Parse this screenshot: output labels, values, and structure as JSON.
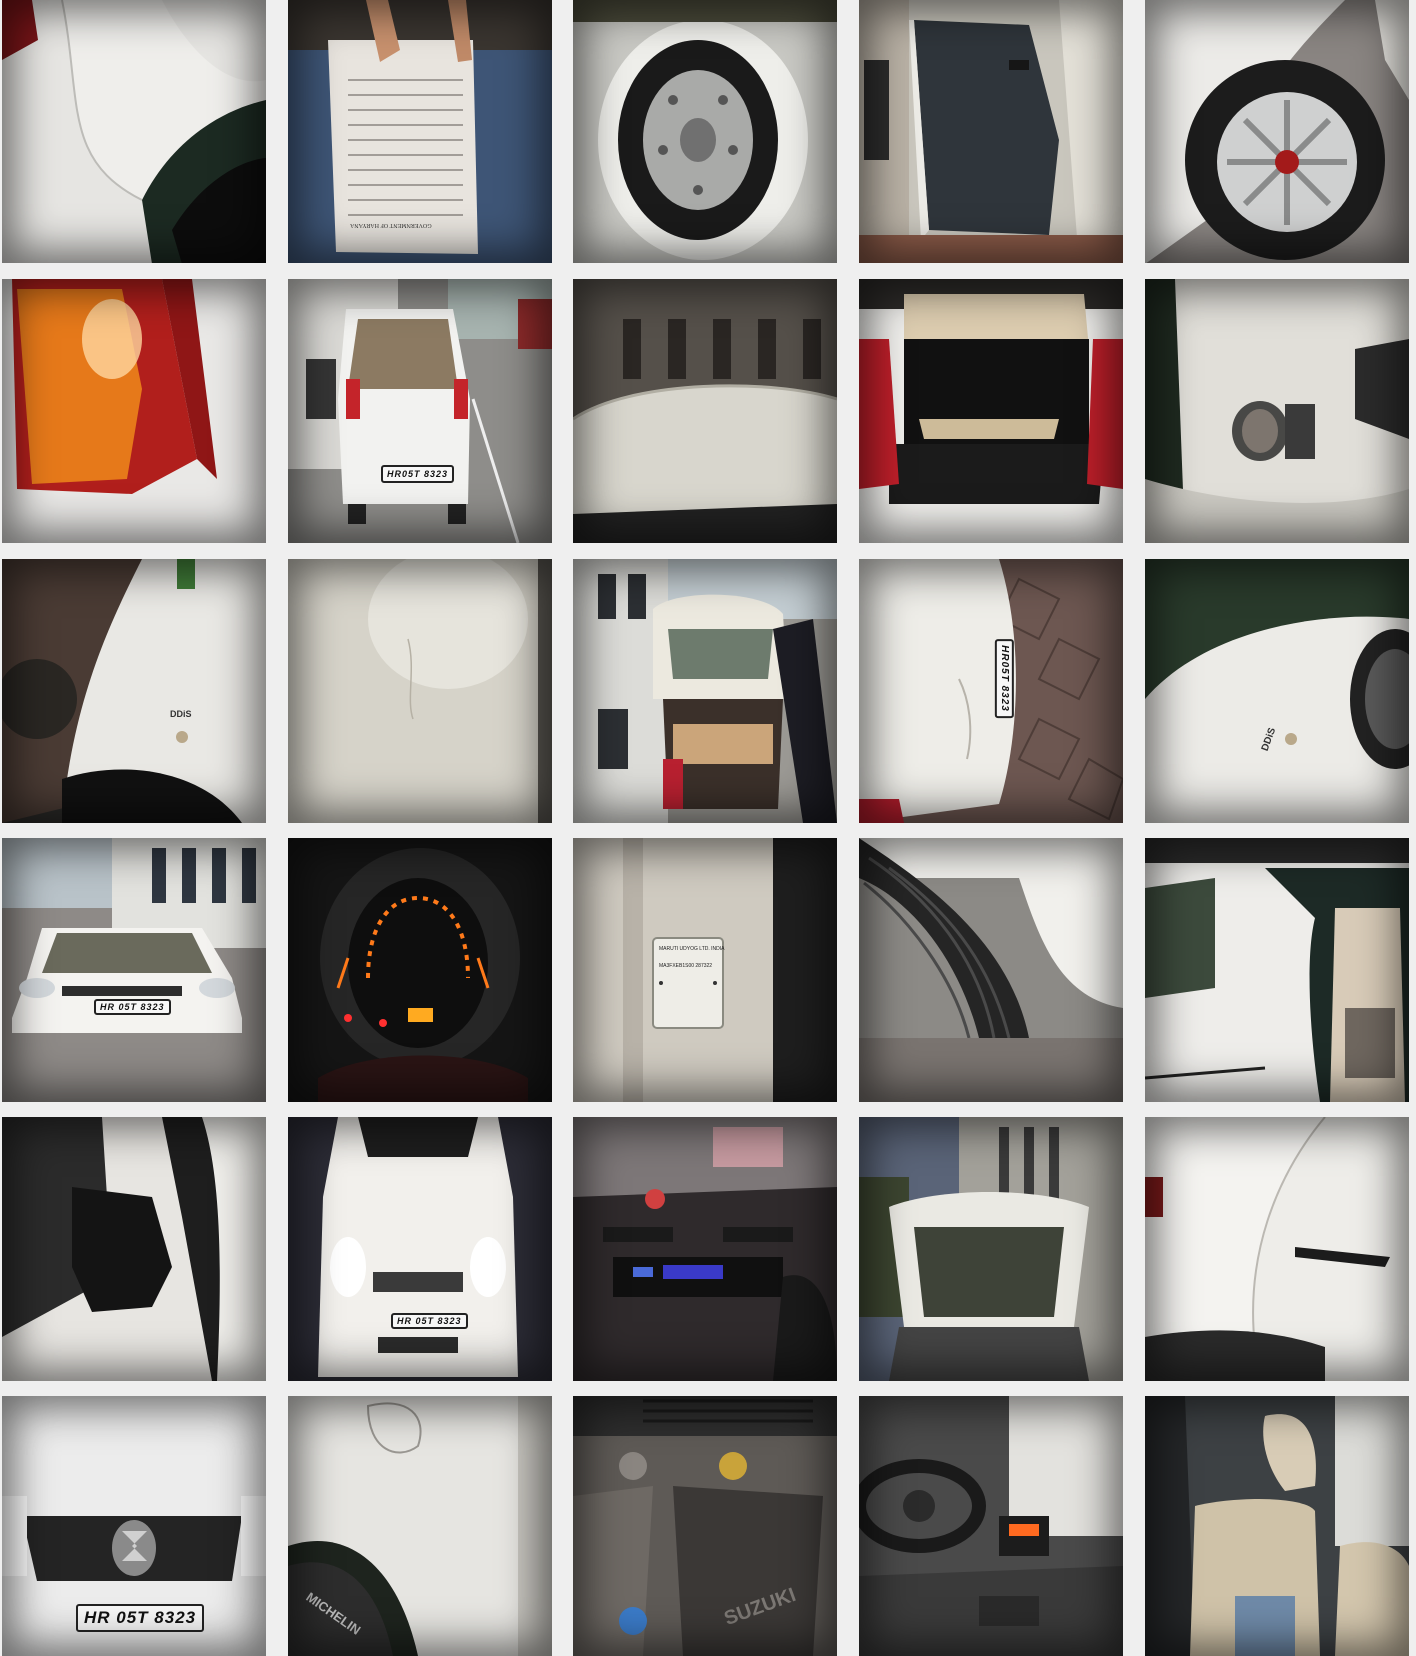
{
  "gallery": {
    "background": "#efefef",
    "tiles": [
      {
        "name": "rear-quarter-white-panel"
      },
      {
        "name": "registration-document",
        "doc_lines": [
          "GOVERNMENT OF HARYANA"
        ]
      },
      {
        "name": "spare-wheel-boot"
      },
      {
        "name": "open-door-interior-panel"
      },
      {
        "name": "front-wheel-hubcap"
      },
      {
        "name": "tail-lamp-closeup"
      },
      {
        "name": "rear-view-on-street",
        "plate": "HR05T 8323"
      },
      {
        "name": "roof-reflection"
      },
      {
        "name": "boot-open-seat-back"
      },
      {
        "name": "fog-lamp-bumper"
      },
      {
        "name": "front-fender-ddis-badge",
        "badge": "DDiS"
      },
      {
        "name": "white-panel-scratch"
      },
      {
        "name": "tailgate-open-street"
      },
      {
        "name": "rear-bumper-plate-scuff",
        "plate": "HR05T 8323"
      },
      {
        "name": "fender-ddis-badge-night",
        "badge": "DDiS"
      },
      {
        "name": "front-view-parked",
        "plate": "HR 05T 8323"
      },
      {
        "name": "instrument-cluster-lit"
      },
      {
        "name": "vin-plate-pillar",
        "vin_lines": [
          "MARUTI UDYOG LTD. INDIA",
          "MA3FXEB1S00 287322"
        ]
      },
      {
        "name": "tyre-tread-closeup"
      },
      {
        "name": "rear-door-window-seat"
      },
      {
        "name": "side-mirror-black"
      },
      {
        "name": "front-headlights-on-night",
        "plate": "HR 05T 8323"
      },
      {
        "name": "dashboard-stereo"
      },
      {
        "name": "bonnet-open-dusk"
      },
      {
        "name": "rear-door-handle-side"
      },
      {
        "name": "front-grille-logo-closeup",
        "plate": "HR 05T 8323"
      },
      {
        "name": "fuel-lid-fender-tyre",
        "tyre_text": "MICHELIN"
      },
      {
        "name": "engine-bay-suzuki-cover",
        "engine_text": "SUZUKI"
      },
      {
        "name": "steering-dashboard-interior"
      },
      {
        "name": "beige-seat-covers"
      }
    ]
  }
}
